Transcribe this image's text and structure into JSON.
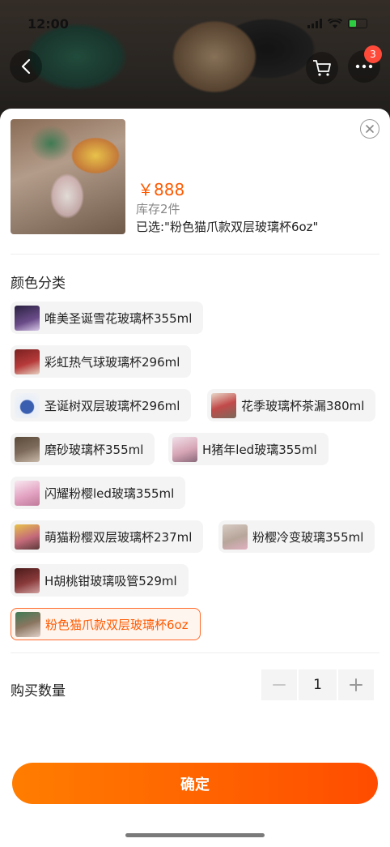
{
  "status_bar": {
    "time": "12:00"
  },
  "header": {
    "cart_badge": "3"
  },
  "product": {
    "price": "￥888",
    "stock": "库存2件",
    "selected": "已选:\"粉色猫爪款双层玻璃杯6oz\""
  },
  "color_section": {
    "title": "颜色分类",
    "options": [
      {
        "label": "唯美圣诞雪花玻璃杯355ml",
        "thumb": "#6b4c8a"
      },
      {
        "label": "彩虹热气球玻璃杯296ml",
        "thumb": "#b73a3a"
      },
      {
        "label": "圣诞树双层玻璃杯296ml",
        "thumb": "#3b5fb0"
      },
      {
        "label": "花季玻璃杯茶漏380ml",
        "thumb": "#c24a4a"
      },
      {
        "label": "磨砂玻璃杯355ml",
        "thumb": "#7d6a5a"
      },
      {
        "label": "H猪年led玻璃355ml",
        "thumb": "#d7a6b6"
      },
      {
        "label": "闪耀粉樱led玻璃355ml",
        "thumb": "#e3a3c2"
      },
      {
        "label": "萌猫粉樱双层玻璃杯237ml",
        "thumb": "#c46a7a"
      },
      {
        "label": "粉樱冷变玻璃355ml",
        "thumb": "#b7a59a"
      },
      {
        "label": "H胡桃钳玻璃吸管529ml",
        "thumb": "#8a3a3a"
      },
      {
        "label": "粉色猫爪款双层玻璃杯6oz",
        "thumb": "#8a7560",
        "active": true
      }
    ]
  },
  "quantity": {
    "label": "购买数量",
    "value": "1"
  },
  "confirm_label": "确定",
  "colors": {
    "accent": "#ff5a00",
    "chip_bg": "#f4f4f4"
  }
}
